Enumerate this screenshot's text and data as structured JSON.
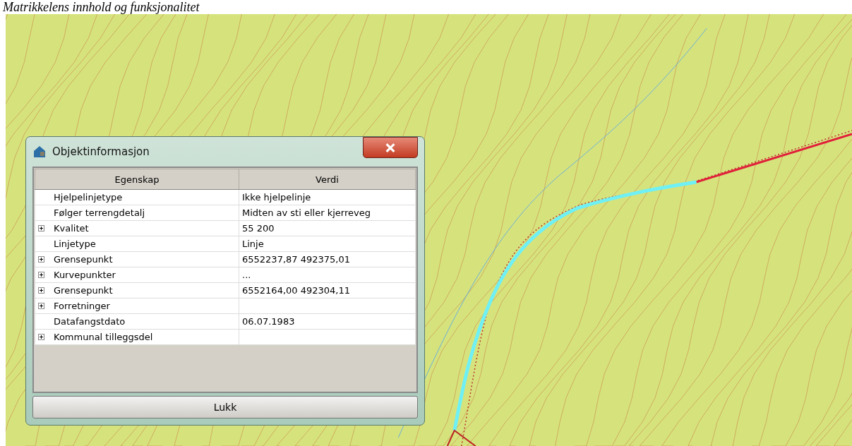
{
  "caption": "Matrikkelens innhold og funksjonalitet",
  "dialog": {
    "title": "Objektinformasjon",
    "table": {
      "columns": [
        "Egenskap",
        "Verdi"
      ],
      "rows": [
        {
          "name": "Hjelpelinjetype",
          "value": "Ikke hjelpelinje",
          "expandable": false
        },
        {
          "name": "Følger terrengdetalj",
          "value": "Midten av sti eller kjerreveg",
          "expandable": false
        },
        {
          "name": "Kvalitet",
          "value": "55  200",
          "expandable": true
        },
        {
          "name": "Linjetype",
          "value": "Linje",
          "expandable": false
        },
        {
          "name": "Grensepunkt",
          "value": "6552237,87 492375,01",
          "expandable": true
        },
        {
          "name": "Kurvepunkter",
          "value": "...",
          "expandable": true
        },
        {
          "name": "Grensepunkt",
          "value": "6552164,00 492304,11",
          "expandable": true
        },
        {
          "name": "Forretninger",
          "value": "",
          "expandable": true
        },
        {
          "name": "Datafangstdato",
          "value": "06.07.1983",
          "expandable": false
        },
        {
          "name": "Kommunal tilleggsdel",
          "value": "",
          "expandable": true
        }
      ]
    },
    "button": "Lukk"
  }
}
